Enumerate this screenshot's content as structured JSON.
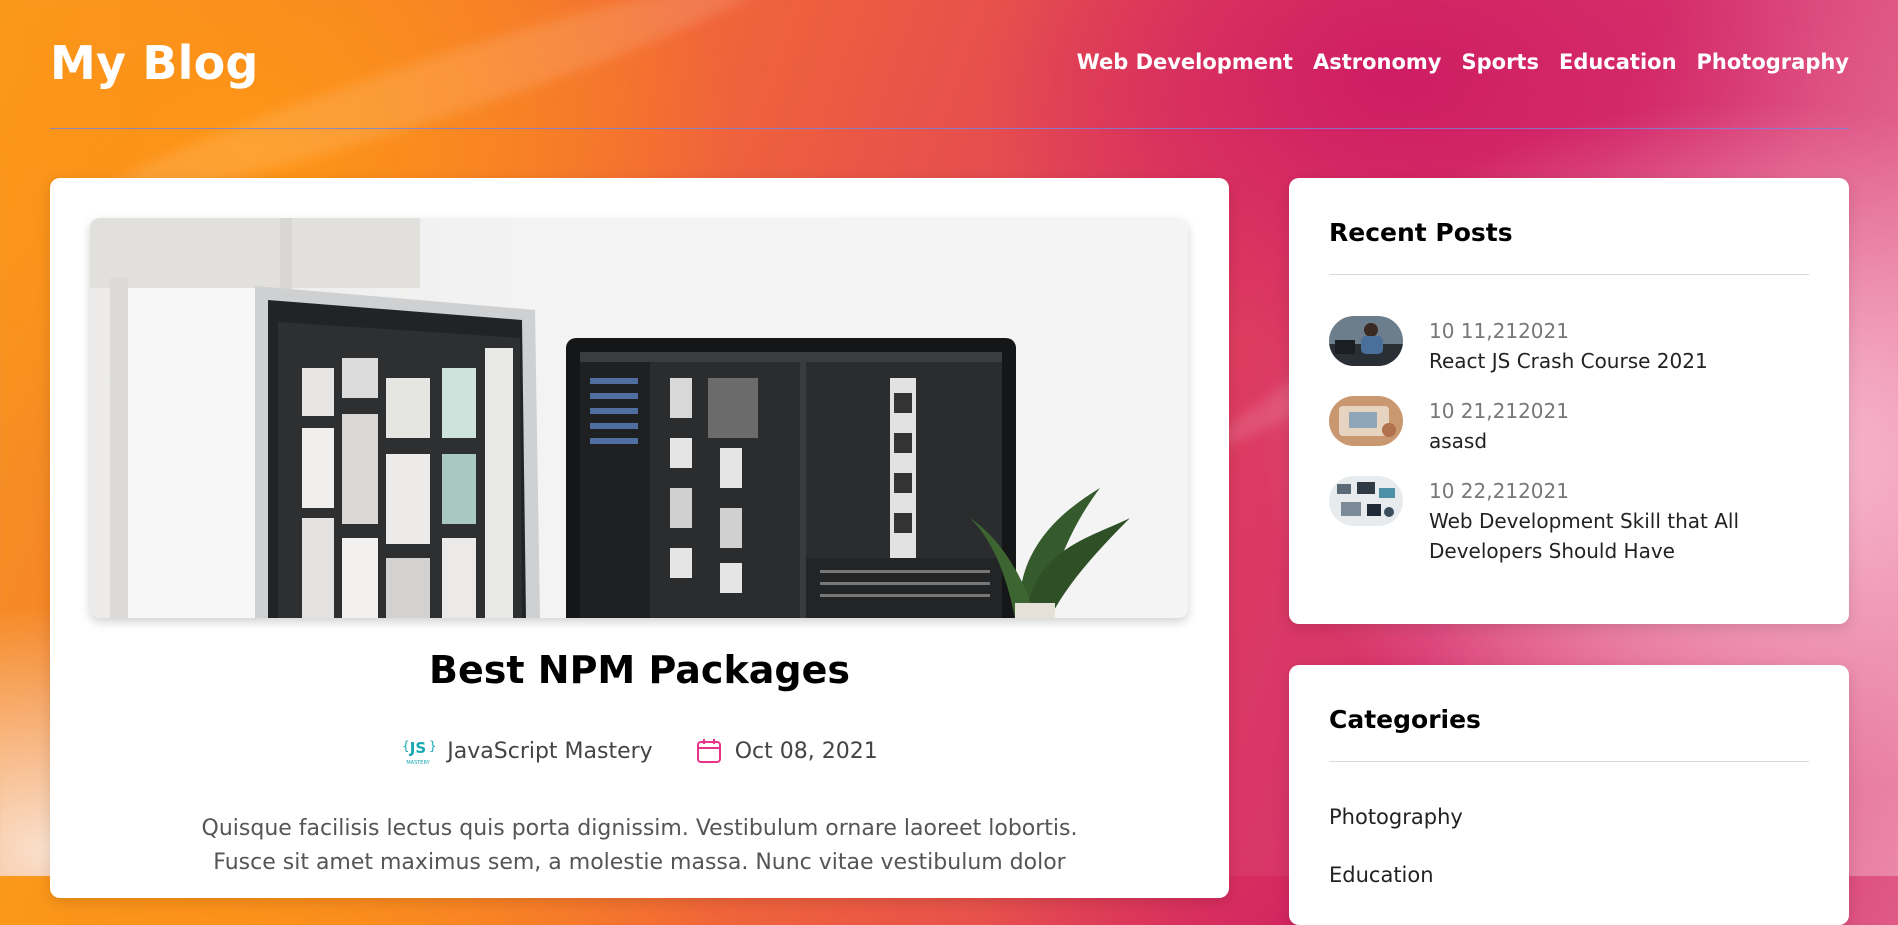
{
  "site": {
    "title": "My Blog"
  },
  "nav": [
    "Web Development",
    "Astronomy",
    "Sports",
    "Education",
    "Photography"
  ],
  "post": {
    "title": "Best NPM Packages",
    "author": "JavaScript Mastery",
    "author_logo_text": "JS",
    "author_logo_subtext": "MASTERY",
    "date": "Oct 08, 2021",
    "excerpt": "Quisque facilisis lectus quis porta dignissim. Vestibulum ornare laoreet lobortis. Fusce sit amet maximus sem, a molestie massa. Nunc vitae vestibulum dolor"
  },
  "recent_posts": {
    "heading": "Recent Posts",
    "items": [
      {
        "date": "10 11,212021",
        "title": "React JS Crash Course 2021"
      },
      {
        "date": "10 21,212021",
        "title": "asasd"
      },
      {
        "date": "10 22,212021",
        "title": "Web Development Skill that All Developers Should Have"
      }
    ]
  },
  "categories": {
    "heading": "Categories",
    "items": [
      "Photography",
      "Education"
    ]
  },
  "colors": {
    "accent_pink": "#e8338a",
    "js_logo_teal": "#16a7b5"
  }
}
